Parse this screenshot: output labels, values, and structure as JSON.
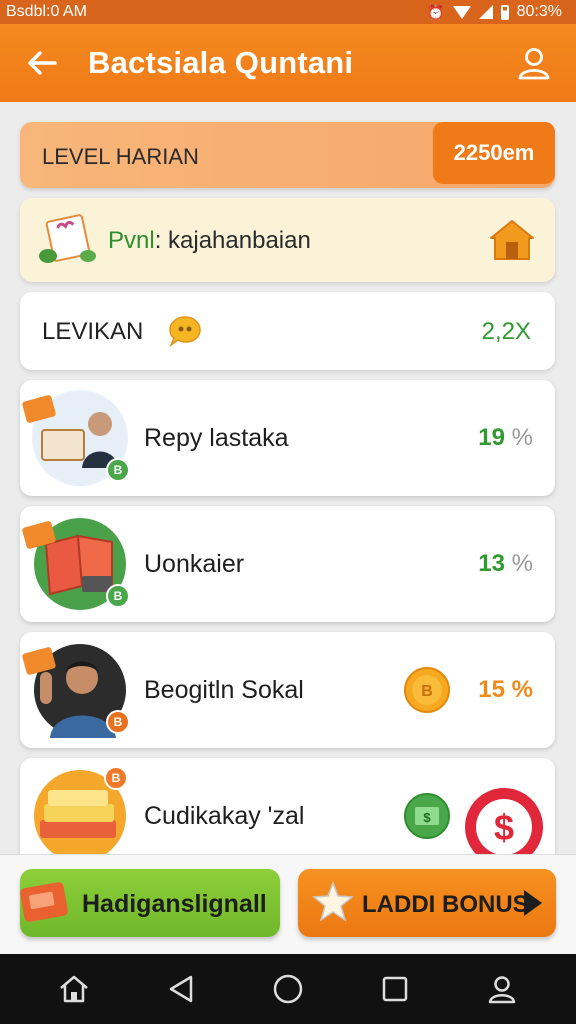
{
  "status_bar": {
    "time": "Bsdbl:0 AM",
    "battery": "80:3%"
  },
  "app_bar": {
    "title": "Bactsiala Quntani"
  },
  "level": {
    "label": "LEVEL HARIAN",
    "value": "2250em"
  },
  "promo": {
    "text_a": "Pvnl",
    "text_b": ": kajahanbaian"
  },
  "levikan": {
    "label": "LEVIKAN",
    "multiplier": "2,2X"
  },
  "items": [
    {
      "name": "Repy lastaka",
      "num": "19",
      "pct": "%"
    },
    {
      "name": "Uonkaier",
      "num": "13",
      "pct": "%"
    },
    {
      "name": "Beogitln Sokal",
      "num": "15",
      "pct": "%"
    },
    {
      "name": "Cudikakay 'zal"
    }
  ],
  "bottom": {
    "left_button": "Hadiganslignall",
    "right_button": "LADDI BONUS"
  },
  "colors": {
    "accent": "#ef7a17",
    "green": "#2f9a2f",
    "button_green": "#7cc232"
  },
  "icons": [
    "back-arrow-icon",
    "profile-icon",
    "house-icon",
    "chat-bubble-icon",
    "coin-icon",
    "dollar-icon",
    "star-icon",
    "play-arrow-icon"
  ]
}
